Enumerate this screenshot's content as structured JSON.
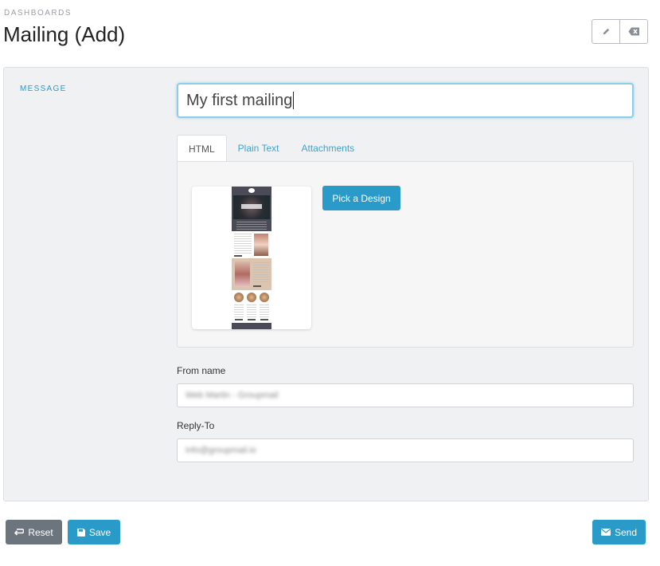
{
  "header": {
    "breadcrumb": "DASHBOARDS",
    "title": "Mailing (Add)",
    "toolbar": [
      {
        "icon": "pencil-icon"
      },
      {
        "icon": "backspace-icon"
      }
    ]
  },
  "form": {
    "section_label": "MESSAGE",
    "subject_value": "My first mailing",
    "tabs": [
      {
        "label": "HTML",
        "active": true
      },
      {
        "label": "Plain Text",
        "active": false
      },
      {
        "label": "Attachments",
        "active": false
      }
    ],
    "pick_design_label": "Pick a Design",
    "from_name": {
      "label": "From name",
      "value": "Web Martin - Groupmail"
    },
    "reply_to": {
      "label": "Reply-To",
      "value": "info@groupmail.io"
    }
  },
  "actions": {
    "reset_label": "Reset",
    "save_label": "Save",
    "send_label": "Send"
  },
  "colors": {
    "accent": "#2a9ac9",
    "secondary": "#6c757d",
    "panel_bg": "#f0f1f3"
  }
}
